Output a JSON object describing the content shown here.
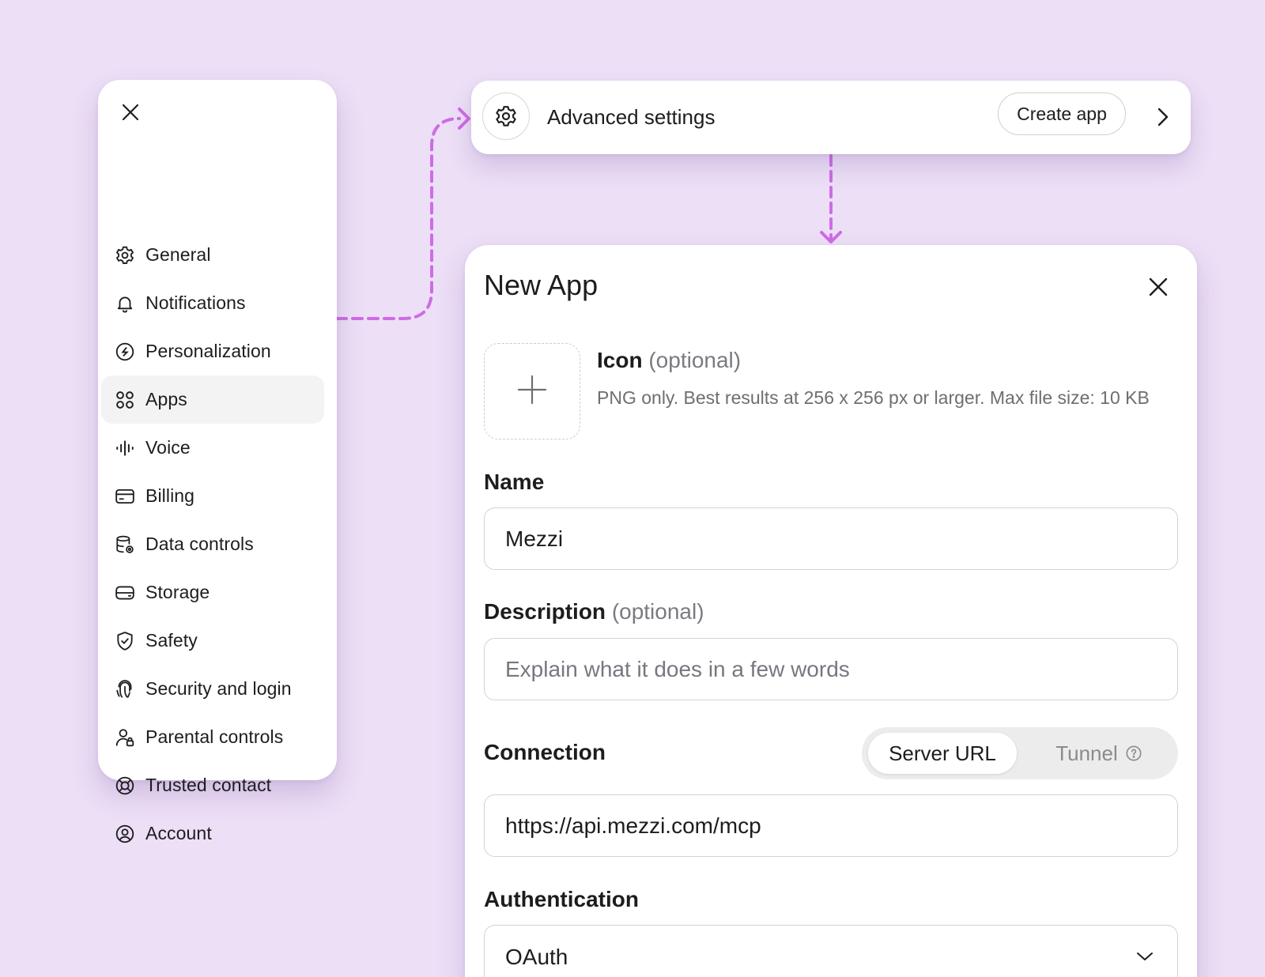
{
  "sidebar": {
    "close_icon": "close-icon",
    "items": [
      {
        "label": "General",
        "icon": "gear-icon"
      },
      {
        "label": "Notifications",
        "icon": "bell-icon"
      },
      {
        "label": "Personalization",
        "icon": "personalization-icon"
      },
      {
        "label": "Apps",
        "icon": "apps-grid-icon",
        "active": true
      },
      {
        "label": "Voice",
        "icon": "voice-wave-icon"
      },
      {
        "label": "Billing",
        "icon": "credit-card-icon"
      },
      {
        "label": "Data controls",
        "icon": "database-gear-icon"
      },
      {
        "label": "Storage",
        "icon": "storage-drive-icon"
      },
      {
        "label": "Safety",
        "icon": "shield-check-icon"
      },
      {
        "label": "Security and login",
        "icon": "fingerprint-icon"
      },
      {
        "label": "Parental controls",
        "icon": "user-lock-icon"
      },
      {
        "label": "Trusted contact",
        "icon": "lifebuoy-icon"
      },
      {
        "label": "Account",
        "icon": "user-circle-icon"
      }
    ]
  },
  "advanced_bar": {
    "title": "Advanced settings",
    "create_label": "Create app"
  },
  "dialog": {
    "title": "New App",
    "icon_label": "Icon",
    "icon_optional": "(optional)",
    "icon_help": "PNG only. Best results at 256 x 256 px or larger. Max file size: 10 KB",
    "name_label": "Name",
    "name_value": "Mezzi",
    "description_label": "Description",
    "description_optional": "(optional)",
    "description_placeholder": "Explain what it does in a few words",
    "connection_label": "Connection",
    "connection_options": [
      "Server URL",
      "Tunnel"
    ],
    "connection_selected": "Server URL",
    "url_value": "https://api.mezzi.com/mcp",
    "auth_label": "Authentication",
    "auth_value": "OAuth"
  },
  "colors": {
    "background": "#ecdff6",
    "connector": "#cf6be6",
    "card": "#ffffff",
    "active_item": "#f3f3f3"
  }
}
